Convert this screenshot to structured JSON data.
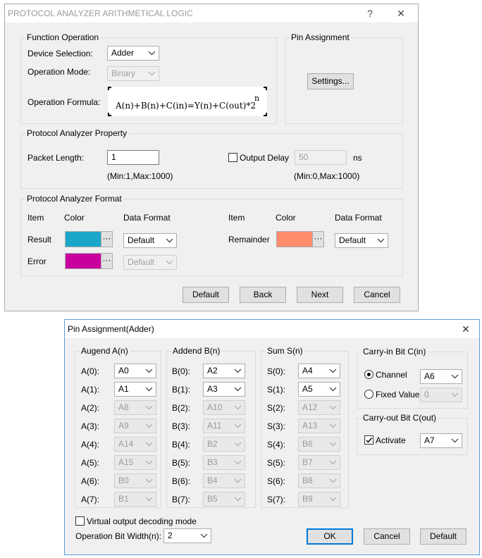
{
  "dialog1": {
    "title": "PROTOCOL ANALYZER ARITHMETICAL LOGIC",
    "help_glyph": "?",
    "close_glyph": "✕",
    "function_operation": {
      "group_label": "Function Operation",
      "device_selection_label": "Device Selection:",
      "device_selection_value": "Adder",
      "operation_mode_label": "Operation Mode:",
      "operation_mode_value": "Binary",
      "operation_formula_label": "Operation Formula:",
      "formula": "A(n)+B(n)+C(in)=Y(n)+C(out)*2",
      "formula_superscript": "n"
    },
    "pin_assignment": {
      "group_label": "Pin Assignment",
      "settings_button": "Settings..."
    },
    "property": {
      "group_label": "Protocol Analyzer Property",
      "packet_length_label": "Packet Length:",
      "packet_length_value": "1",
      "packet_length_range": "(Min:1,Max:1000)",
      "output_delay_label": "Output Delay",
      "output_delay_checked": false,
      "output_delay_value": "50",
      "output_delay_unit": "ns",
      "output_delay_range": "(Min:0,Max:1000)"
    },
    "format": {
      "group_label": "Protocol Analyzer Format",
      "col_item": "Item",
      "col_color": "Color",
      "col_data_format": "Data Format",
      "result_label": "Result",
      "result_color": "#1aa6c8",
      "result_format": "Default",
      "error_label": "Error",
      "error_color": "#c8009c",
      "error_format": "Default",
      "remainder_label": "Remainder",
      "remainder_color": "#ff8c6c",
      "remainder_format": "Default",
      "dots": "···"
    },
    "buttons": {
      "default": "Default",
      "back": "Back",
      "next": "Next",
      "cancel": "Cancel"
    }
  },
  "dialog2": {
    "title": "Pin Assignment(Adder)",
    "close_glyph": "✕",
    "augend": {
      "group_label": "Augend A(n)",
      "rows": [
        {
          "label": "A(0):",
          "value": "A0",
          "enabled": true
        },
        {
          "label": "A(1):",
          "value": "A1",
          "enabled": true
        },
        {
          "label": "A(2):",
          "value": "A8",
          "enabled": false
        },
        {
          "label": "A(3):",
          "value": "A9",
          "enabled": false
        },
        {
          "label": "A(4):",
          "value": "A14",
          "enabled": false
        },
        {
          "label": "A(5):",
          "value": "A15",
          "enabled": false
        },
        {
          "label": "A(6):",
          "value": "B0",
          "enabled": false
        },
        {
          "label": "A(7):",
          "value": "B1",
          "enabled": false
        }
      ]
    },
    "addend": {
      "group_label": "Addend B(n)",
      "rows": [
        {
          "label": "B(0):",
          "value": "A2",
          "enabled": true
        },
        {
          "label": "B(1):",
          "value": "A3",
          "enabled": true
        },
        {
          "label": "B(2):",
          "value": "A10",
          "enabled": false
        },
        {
          "label": "B(3):",
          "value": "A11",
          "enabled": false
        },
        {
          "label": "B(4):",
          "value": "B2",
          "enabled": false
        },
        {
          "label": "B(5):",
          "value": "B3",
          "enabled": false
        },
        {
          "label": "B(6):",
          "value": "B4",
          "enabled": false
        },
        {
          "label": "B(7):",
          "value": "B5",
          "enabled": false
        }
      ]
    },
    "sum": {
      "group_label": "Sum S(n)",
      "rows": [
        {
          "label": "S(0):",
          "value": "A4",
          "enabled": true
        },
        {
          "label": "S(1):",
          "value": "A5",
          "enabled": true
        },
        {
          "label": "S(2):",
          "value": "A12",
          "enabled": false
        },
        {
          "label": "S(3):",
          "value": "A13",
          "enabled": false
        },
        {
          "label": "S(4):",
          "value": "B6",
          "enabled": false
        },
        {
          "label": "S(5):",
          "value": "B7",
          "enabled": false
        },
        {
          "label": "S(6):",
          "value": "B8",
          "enabled": false
        },
        {
          "label": "S(7):",
          "value": "B9",
          "enabled": false
        }
      ]
    },
    "carry_in": {
      "group_label": "Carry-in Bit C(in)",
      "channel_label": "Channel",
      "channel_value": "A6",
      "fixed_label": "Fixed Value",
      "fixed_value": "0",
      "selected": "Channel"
    },
    "carry_out": {
      "group_label": "Carry-out Bit C(out)",
      "activate_label": "Activate",
      "activate_checked": true,
      "activate_value": "A7"
    },
    "virtual_output_label": "Virtual output decoding mode",
    "virtual_output_checked": false,
    "bit_width_label": "Operation Bit Width(n):",
    "bit_width_value": "2",
    "buttons": {
      "ok": "OK",
      "cancel": "Cancel",
      "default": "Default"
    }
  }
}
